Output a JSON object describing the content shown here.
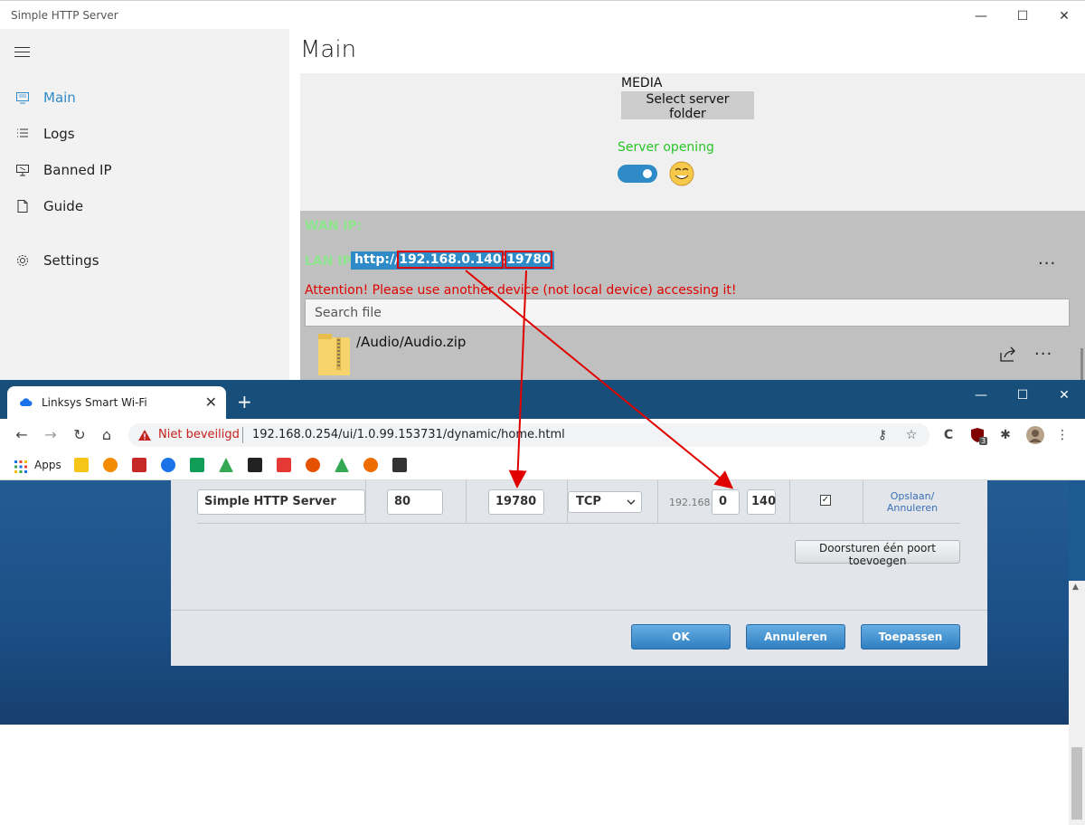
{
  "app": {
    "title": "Simple HTTP Server",
    "window_controls": {
      "minimize": "—",
      "maximize": "☐",
      "close": "✕"
    },
    "nav": [
      {
        "label": "Main",
        "icon": "monitor-icon",
        "active": true
      },
      {
        "label": "Logs",
        "icon": "list-icon"
      },
      {
        "label": "Banned IP",
        "icon": "banned-monitor-icon"
      },
      {
        "label": "Guide",
        "icon": "document-icon"
      },
      {
        "label": "Settings",
        "icon": "gear-icon"
      }
    ],
    "page_title": "Main",
    "media_label": "MEDIA",
    "select_folder_label": "Select server folder",
    "server_status": "Server opening",
    "server_on": true,
    "wan_label": "WAN IP:",
    "lan_label": "LAN IP:",
    "lan_url_prefix": "http://",
    "lan_ip": "192.168.0.140",
    "lan_colon": ":",
    "lan_port": "19780",
    "attention": "Attention! Please use another device (not local device) accessing it!",
    "search_placeholder": "Search file",
    "file_name": "/Audio/Audio.zip",
    "more_dots": "···",
    "colors": {
      "accent": "#2e8bc7",
      "status_green": "#29c629",
      "ip_label_green": "#8de58d",
      "warning_red": "#e00000"
    }
  },
  "browser": {
    "tab_title": "Linksys Smart Wi-Fi",
    "tab_close": "✕",
    "new_tab": "+",
    "window_controls": {
      "minimize": "—",
      "maximize": "☐",
      "close": "✕"
    },
    "not_secure": "Niet beveiligd",
    "url": "192.168.0.254/ui/1.0.99.153731/dynamic/home.html",
    "nav_icons": {
      "back": "←",
      "forward": "→",
      "reload": "↻",
      "home": "⌂"
    },
    "toolbar_icons": {
      "key": "⚷",
      "star": "☆",
      "c": "C",
      "puzzle": "✱",
      "menu": "⋮"
    },
    "extension_badge": "3",
    "apps_label": "Apps",
    "bookmark_colors": [
      "#f5c518",
      "#f28b00",
      "#c62828",
      "#1a73e8",
      "#0f9d58",
      "#34a853",
      "#222222",
      "#e53935",
      "#e65100",
      "#34a853",
      "#ef6c00",
      "#333333"
    ],
    "forward_rule": {
      "application": "Simple HTTP Server",
      "external_port": "80",
      "internal_port": "19780",
      "protocol": "TCP",
      "ip_prefix": "192.168.",
      "ip_third": "0",
      "ip_fourth": "140",
      "enabled_mark": "✓",
      "save_cancel": "Opslaan/ Annuleren"
    },
    "add_port_label": "Doorsturen één poort toevoegen",
    "ok_label": "OK",
    "cancel_label": "Annuleren",
    "apply_label": "Toepassen"
  }
}
